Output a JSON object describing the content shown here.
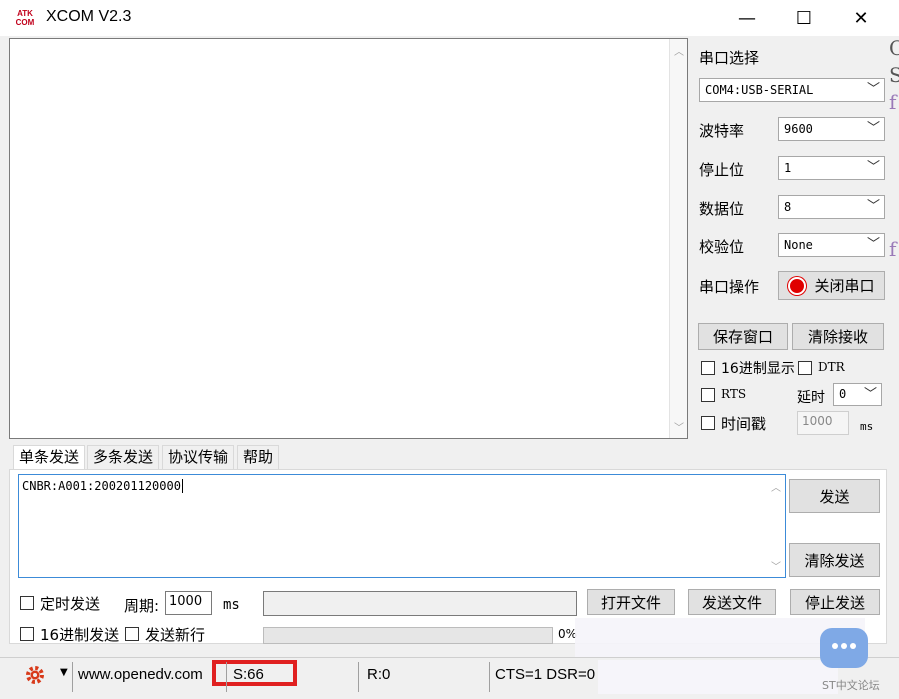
{
  "window": {
    "title": "XCOM V2.3",
    "logo_text": "ATK\nCOM",
    "minimize": "—",
    "maximize": "☐",
    "close": "✕"
  },
  "settings": {
    "port_select_label": "串口选择",
    "port_value": "COM4:USB-SERIAL",
    "baud_label": "波特率",
    "baud_value": "9600",
    "stopbits_label": "停止位",
    "stopbits_value": "1",
    "databits_label": "数据位",
    "databits_value": "8",
    "parity_label": "校验位",
    "parity_value": "None",
    "port_op_label": "串口操作",
    "close_port_button": "关闭串口",
    "save_window_button": "保存窗口",
    "clear_receive_button": "清除接收",
    "hex_display_label": "16进制显示",
    "dtr_label": "DTR",
    "rts_label": "RTS",
    "delay_label": "延时",
    "delay_value": "0",
    "timestamp_label": "时间戳",
    "timestamp_value": "1000",
    "timestamp_unit": "ms"
  },
  "tabs": [
    "单条发送",
    "多条发送",
    "协议传输",
    "帮助"
  ],
  "send": {
    "text": "CNBR:A001:200201120000",
    "send_button": "发送",
    "clear_send_button": "清除发送",
    "timed_send_label": "定时发送",
    "period_label": "周期:",
    "period_value": "1000",
    "period_unit": "ms",
    "open_file_button": "打开文件",
    "send_file_button": "发送文件",
    "stop_send_button": "停止发送",
    "hex_send_label": "16进制发送",
    "newline_label": "发送新行",
    "progress_text": "0%"
  },
  "status": {
    "website": "www.openedv.com",
    "sent": "S:66",
    "received": "R:0",
    "signals": "CTS=1 DSR=0"
  },
  "overlay": {
    "watermark": "ST中文论坛",
    "right_edge_chars": [
      "C",
      "S",
      "f",
      "f"
    ]
  },
  "colors": {
    "accent_blue": "#3c8bd8",
    "highlight_red": "#e02020",
    "port_indicator_red": "#e00000"
  }
}
